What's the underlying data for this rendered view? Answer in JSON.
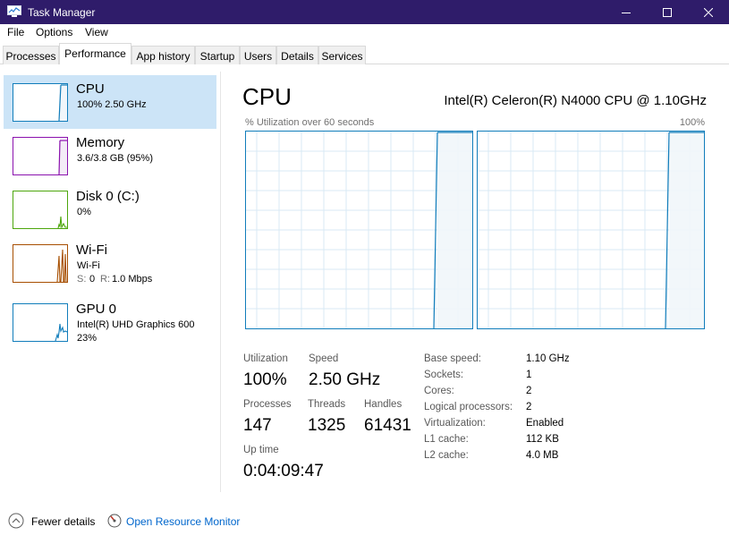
{
  "window": {
    "title": "Task Manager"
  },
  "menu": {
    "items": [
      "File",
      "Options",
      "View"
    ]
  },
  "tabs": [
    "Processes",
    "Performance",
    "App history",
    "Startup",
    "Users",
    "Details",
    "Services"
  ],
  "active_tab": "Performance",
  "sidebar": {
    "items": [
      {
        "name": "CPU",
        "line1": "100%  2.50 GHz",
        "line2": "",
        "color": "#117dbb"
      },
      {
        "name": "Memory",
        "line1": "3.6/3.8 GB (95%)",
        "line2": "",
        "color": "#8b12ae"
      },
      {
        "name": "Disk 0 (C:)",
        "line1": "0%",
        "line2": "",
        "color": "#4da60c"
      },
      {
        "name": "Wi-Fi",
        "line1": "Wi-Fi",
        "line2_s": "S:",
        "line2_s_val": "0",
        "line2_r": "R:",
        "line2_r_val": "1.0 Mbps",
        "color": "#a74f01"
      },
      {
        "name": "GPU 0",
        "line1": "Intel(R) UHD Graphics 600",
        "line2": "23%",
        "color": "#117dbb"
      }
    ]
  },
  "main": {
    "title": "CPU",
    "model": "Intel(R) Celeron(R) N4000 CPU @ 1.10GHz",
    "graph_caption": "% Utilization over 60 seconds",
    "graph_max": "100%",
    "stats": {
      "utilization_label": "Utilization",
      "utilization": "100%",
      "speed_label": "Speed",
      "speed": "2.50 GHz",
      "processes_label": "Processes",
      "processes": "147",
      "threads_label": "Threads",
      "threads": "1325",
      "handles_label": "Handles",
      "handles": "61431",
      "uptime_label": "Up time",
      "uptime": "0:04:09:47"
    },
    "specs": [
      {
        "label": "Base speed:",
        "value": "1.10 GHz"
      },
      {
        "label": "Sockets:",
        "value": "1"
      },
      {
        "label": "Cores:",
        "value": "2"
      },
      {
        "label": "Logical processors:",
        "value": "2"
      },
      {
        "label": "Virtualization:",
        "value": "Enabled"
      },
      {
        "label": "L1 cache:",
        "value": "112 KB"
      },
      {
        "label": "L2 cache:",
        "value": "4.0 MB"
      }
    ]
  },
  "footer": {
    "fewer_details": "Fewer details",
    "resource_monitor": "Open Resource Monitor"
  },
  "colors": {
    "titlebar": "#2f1c6a",
    "selected": "#cce4f7",
    "cpu": "#117dbb",
    "memory": "#8b12ae",
    "disk": "#4da60c",
    "wifi": "#a74f01",
    "link": "#0066cc"
  }
}
